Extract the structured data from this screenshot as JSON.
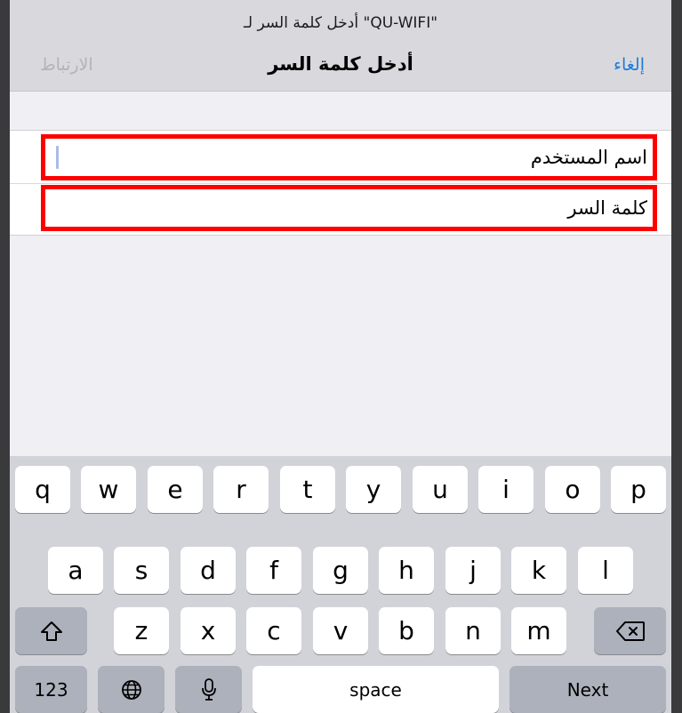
{
  "header": {
    "prompt": "أدخل كلمة السر لـ \"QU-WIFI\"",
    "title": "أدخل كلمة السر",
    "cancel_label": "إلغاء",
    "join_label": "الارتباط"
  },
  "form": {
    "username_label": "اسم المستخدم",
    "password_label": "كلمة السر"
  },
  "keyboard": {
    "row1": [
      "q",
      "w",
      "e",
      "r",
      "t",
      "y",
      "u",
      "i",
      "o",
      "p"
    ],
    "row2": [
      "a",
      "s",
      "d",
      "f",
      "g",
      "h",
      "j",
      "k",
      "l"
    ],
    "row3": [
      "z",
      "x",
      "c",
      "v",
      "b",
      "n",
      "m"
    ],
    "numbers_label": "123",
    "space_label": "space",
    "next_label": "Next",
    "icons": {
      "shift": "shift-icon",
      "delete": "backspace-icon",
      "globe": "globe-icon",
      "mic": "microphone-icon"
    }
  },
  "colors": {
    "accent": "#1e7bd8",
    "highlight_border": "#ff0000",
    "disabled": "#b4b4b8"
  }
}
